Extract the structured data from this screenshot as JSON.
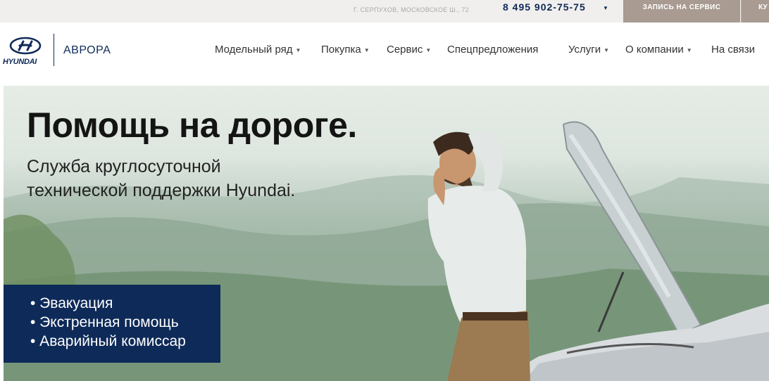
{
  "topbar": {
    "address": "г. Серпухов, Московское ш., 72",
    "phone": "8 495 902-75-75",
    "service_button": "Запись на сервис",
    "second_button": "Ку"
  },
  "header": {
    "brand_wordmark": "HYUNDAI",
    "dealer": "АВРОРА"
  },
  "nav": [
    {
      "label": "Модельный ряд",
      "dropdown": true
    },
    {
      "label": "Покупка",
      "dropdown": true
    },
    {
      "label": "Сервис",
      "dropdown": true
    },
    {
      "label": "Спецпредложения",
      "dropdown": false
    },
    {
      "label": "Услуги",
      "dropdown": true
    },
    {
      "label": "О компании",
      "dropdown": true
    },
    {
      "label": "На связи",
      "dropdown": false
    }
  ],
  "hero": {
    "title": "Помощь на дороге.",
    "subtitle_line1": "Служба круглосуточной",
    "subtitle_line2": "технической поддержки Hyundai.",
    "features": [
      "• Эвакуация",
      "• Экстренная помощь",
      "• Аварийный комиссар"
    ]
  },
  "colors": {
    "brand_navy": "#0e2a58",
    "topbar_bg": "#f1efed",
    "service_button_bg": "#a99b92"
  }
}
